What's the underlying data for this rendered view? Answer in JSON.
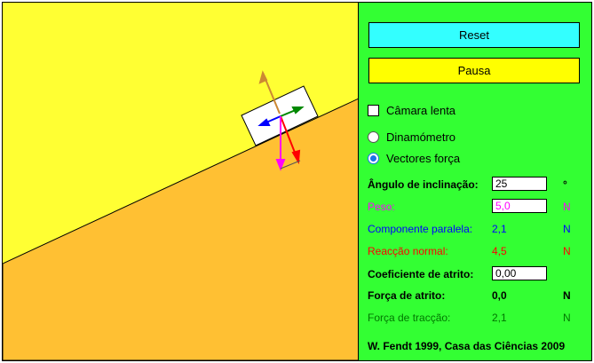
{
  "controls": {
    "reset_label": "Reset",
    "pause_label": "Pausa",
    "slow_motion_label": "Câmara lenta",
    "dynamometer_label": "Dinamómetro",
    "force_vectors_label": "Vectores força"
  },
  "rows": {
    "angle": {
      "label": "Ângulo de inclinação:",
      "value": "25",
      "unit": "°"
    },
    "weight": {
      "label": "Peso:",
      "value": "5,0",
      "unit": "N",
      "color": "#ff00ff"
    },
    "parallel": {
      "label": "Componente paralela:",
      "value": "2,1",
      "unit": "N",
      "color": "#0000ff"
    },
    "normal": {
      "label": "Reacção normal:",
      "value": "4,5",
      "unit": "N",
      "color": "#ff0000"
    },
    "friction_coef": {
      "label": "Coeficiente de atrito:",
      "value": "0,00"
    },
    "friction_force": {
      "label": "Força de atrito:",
      "value": "0,0",
      "unit": "N"
    },
    "traction_force": {
      "label": "Força de tracção:",
      "value": "2,1",
      "unit": "N",
      "color": "#007700"
    }
  },
  "credits": "W. Fendt 1999,  Casa das Ciências 2009",
  "colors": {
    "sky": "#ffff33",
    "ground": "#ffc033",
    "panel": "#33ff33",
    "reset_button": "#33ffff",
    "pause_button": "#ffff00",
    "vector_weight": "#ff00ff",
    "vector_parallel": "#0000ff",
    "vector_normal": "#ff0000",
    "vector_traction": "#008800",
    "vector_reaction": "#cc8833"
  },
  "state": {
    "slow_motion": false,
    "mode": "force_vectors"
  }
}
